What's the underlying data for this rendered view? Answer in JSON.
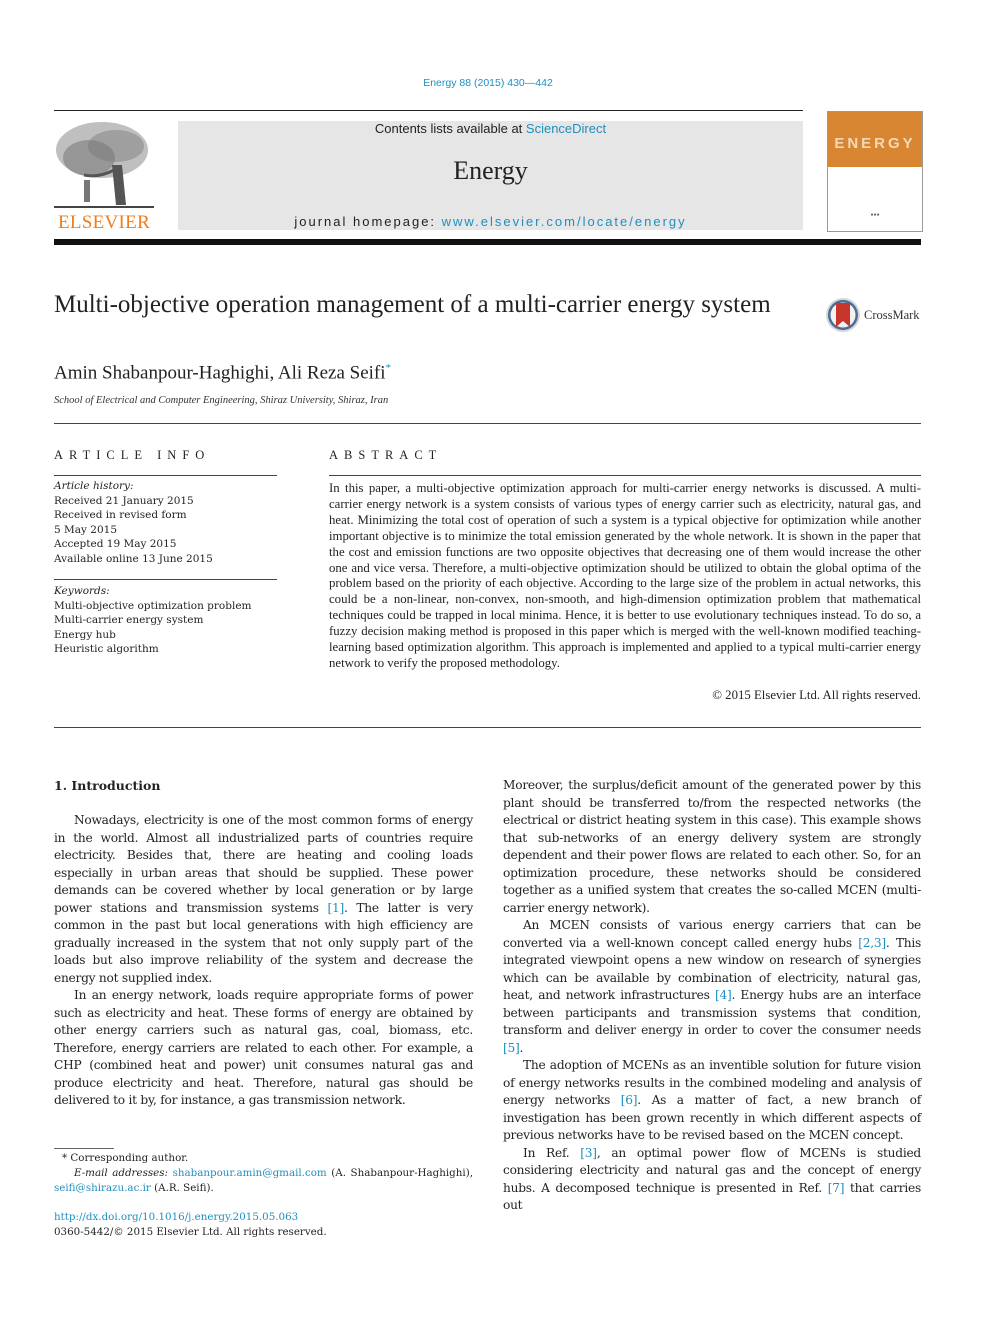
{
  "header": {
    "journal_ref": "Energy 88 (2015) 430—442",
    "publisher_logo_text": "ELSEVIER",
    "contents_prefix": "Contents lists available at ",
    "contents_link": "ScienceDirect",
    "journal_name": "Energy",
    "homepage_prefix": "journal homepage: ",
    "homepage_link": "www.elsevier.com/locate/energy",
    "cover_title": "ENERGY"
  },
  "article": {
    "title": "Multi-objective operation management of a multi-carrier energy system",
    "crossmark_label": "CrossMark",
    "authors": "Amin Shabanpour-Haghighi, Ali Reza Seifi",
    "author_mark": "*",
    "affiliation": "School of Electrical and Computer Engineering, Shiraz University, Shiraz, Iran"
  },
  "article_info": {
    "heading": "ARTICLE INFO",
    "history_label": "Article history:",
    "history": [
      "Received 21 January 2015",
      "Received in revised form",
      "5 May 2015",
      "Accepted 19 May 2015",
      "Available online 13 June 2015"
    ],
    "keywords_label": "Keywords:",
    "keywords": [
      "Multi-objective optimization problem",
      "Multi-carrier energy system",
      "Energy hub",
      "Heuristic algorithm"
    ]
  },
  "abstract": {
    "heading": "ABSTRACT",
    "text": "In this paper, a multi-objective optimization approach for multi-carrier energy networks is discussed. A multi-carrier energy network is a system consists of various types of energy carrier such as electricity, natural gas, and heat. Minimizing the total cost of operation of such a system is a typical objective for optimization while another important objective is to minimize the total emission generated by the whole network. It is shown in the paper that the cost and emission functions are two opposite objectives that decreasing one of them would increase the other one and vice versa. Therefore, a multi-objective optimization should be utilized to obtain the global optima of the problem based on the priority of each objective. According to the large size of the problem in actual networks, this could be a non-linear, non-convex, non-smooth, and high-dimension optimization problem that mathematical techniques could be trapped in local minima. Hence, it is better to use evolutionary techniques instead. To do so, a fuzzy decision making method is proposed in this paper which is merged with the well-known modified teaching-learning based optimization algorithm. This approach is implemented and applied to a typical multi-carrier energy network to verify the proposed methodology.",
    "copyright": "© 2015 Elsevier Ltd. All rights reserved."
  },
  "body": {
    "section_heading": "1.  Introduction",
    "left_column": [
      {
        "before": "Nowadays, electricity is one of the most common forms of energy in the world. Almost all industrialized parts of countries require electricity. Besides that, there are heating and cooling loads especially in urban areas that should be supplied. These power demands can be covered whether by local generation or by large power stations and transmission systems ",
        "ref": "[1]",
        "after": ". The latter is very common in the past but local generations with high efficiency are gradually increased in the system that not only supply part of the loads but also improve reliability of the system and decrease the energy not supplied index."
      },
      {
        "before": "In an energy network, loads require appropriate forms of power such as electricity and heat. These forms of energy are obtained by other energy carriers such as natural gas, coal, biomass, etc. Therefore, energy carriers are related to each other. For example, a CHP (combined heat and power) unit consumes natural gas and produce electricity and heat. Therefore, natural gas should be delivered to it by, for instance, a gas transmission network.",
        "ref": "",
        "after": ""
      }
    ],
    "right_column": {
      "continuation": "Moreover, the surplus/deficit amount of the generated power by this plant should be transferred to/from the respected networks (the electrical or district heating system in this case). This example shows that sub-networks of an energy delivery system are strongly dependent and their power flows are related to each other. So, for an optimization procedure, these networks should be considered together as a unified system that creates the so-called MCEN (multi-carrier energy network).",
      "p2_a": "An MCEN consists of various energy carriers that can be converted via a well-known concept called energy hubs ",
      "p2_ref1": "[2,3]",
      "p2_b": ". This integrated viewpoint opens a new window on research of synergies which can be available by combination of electricity, natural gas, heat, and network infrastructures ",
      "p2_ref2": "[4]",
      "p2_c": ". Energy hubs are an interface between participants and transmission systems that condition, transform and deliver energy in order to cover the consumer needs ",
      "p2_ref3": "[5]",
      "p2_d": ".",
      "p3_a": "The adoption of MCENs as an inventible solution for future vision of energy networks results in the combined modeling and analysis of energy networks ",
      "p3_ref": "[6]",
      "p3_b": ". As a matter of fact, a new branch of investigation has been grown recently in which different aspects of previous networks have to be revised based on the MCEN concept.",
      "p4_a": "In Ref. ",
      "p4_ref1": "[3]",
      "p4_b": ", an optimal power flow of MCENs is studied considering electricity and natural gas and the concept of energy hubs. A decomposed technique is presented in Ref. ",
      "p4_ref2": "[7]",
      "p4_c": " that carries out"
    }
  },
  "footnotes": {
    "corresponding": "* Corresponding author.",
    "email_label": "E-mail addresses: ",
    "email1": "shabanpour.amin@gmail.com",
    "email1_owner": " (A. Shabanpour-Haghighi),",
    "email2": "seifi@shirazu.ac.ir",
    "email2_owner": " (A.R. Seifi).",
    "doi": "http://dx.doi.org/10.1016/j.energy.2015.05.063",
    "issn": "0360-5442/© 2015 Elsevier Ltd. All rights reserved."
  },
  "colors": {
    "link": "#1f8fc0",
    "elsevier_orange": "#f07d1a",
    "masthead_bg": "#e6e6e6",
    "cover_orange": "#d98632"
  }
}
